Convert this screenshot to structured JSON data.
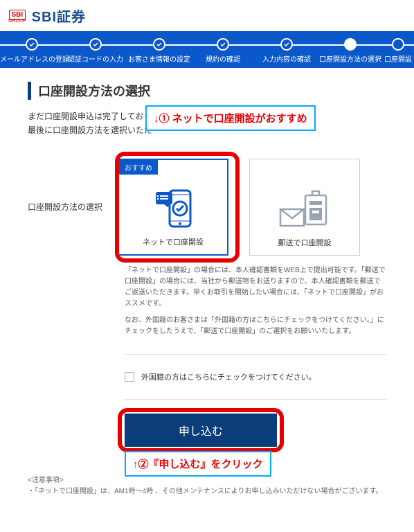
{
  "header": {
    "logo_group": "SBI",
    "logo_sub": "GROUP",
    "brand": "SBI証券"
  },
  "stepper": {
    "items": [
      {
        "label": "メールアドレスの登録",
        "done": true
      },
      {
        "label": "認証コードの入力",
        "done": true
      },
      {
        "label": "お客さま情報の設定",
        "done": true
      },
      {
        "label": "規約の確認",
        "done": true
      },
      {
        "label": "入力内容の確認",
        "done": true
      },
      {
        "label": "口座開設方法の選択",
        "current": true
      },
      {
        "label": "口座開設",
        "done": false
      }
    ]
  },
  "page": {
    "title": "口座開設方法の選択",
    "intro_line1": "まだ口座開設申込は完了しており",
    "intro_line2": "最後に口座開設方法を選択いただ"
  },
  "annotations": {
    "a1": "↓① ネットで口座開設がおすすめ",
    "a2": "↑②『申し込む』をクリック"
  },
  "selection": {
    "label": "口座開設方法の選択",
    "recommended_badge": "おすすめ",
    "option_net": "ネットで口座開設",
    "option_mail": "郵送で口座開設",
    "desc1": "「ネットで口座開設」の場合には、本人確認書類をWEB上で提出可能です。「郵送で口座開設」の場合には、当社から郵送物をお送りますので、本人確認書類を郵送でご返送いただきます。早くお取引を開始したい場合には、「ネットで口座開設」がおススメです。",
    "desc2": "なお、外国籍のお客さまは「外国籍の方はこちらにチェックをつけてください。」にチェックをしたうえで、「郵送で口座開設」のご選択をお願いいたします。"
  },
  "checkbox": {
    "label": "外国籍の方はこちらにチェックをつけてください。"
  },
  "submit": {
    "label": "申し込む"
  },
  "notes": {
    "heading": "<注意事項>",
    "line1": "・「ネットで口座開設」は、AM1時～4時                                                                    、その他メンテナンスによりお申し込みいただけない場合がございます。"
  }
}
